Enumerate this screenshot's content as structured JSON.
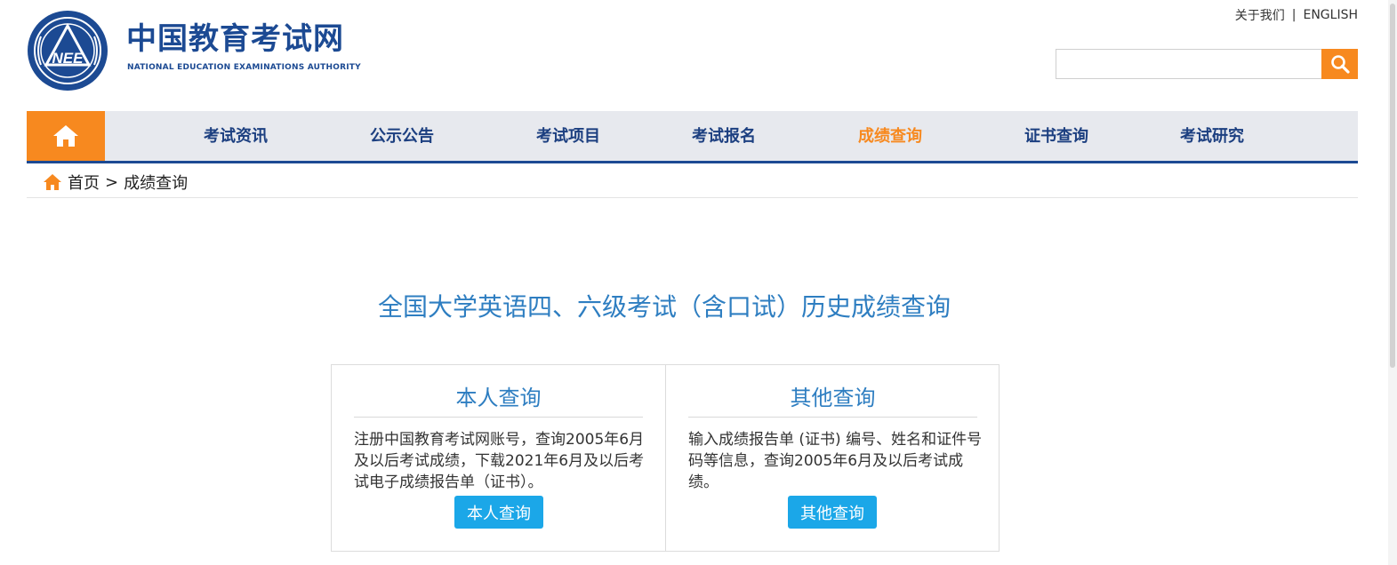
{
  "header": {
    "logo_text": "NEE",
    "site_title": "中国教育考试网",
    "site_subtitle": "NATIONAL EDUCATION EXAMINATIONS AUTHORITY",
    "links": {
      "about": "关于我们",
      "separator": "|",
      "english": "ENGLISH"
    },
    "search": {
      "value": "",
      "placeholder": ""
    }
  },
  "nav": {
    "items": [
      {
        "label": "考试资讯"
      },
      {
        "label": "公示公告"
      },
      {
        "label": "考试项目"
      },
      {
        "label": "考试报名"
      },
      {
        "label": "成绩查询",
        "active": true
      },
      {
        "label": "证书查询"
      },
      {
        "label": "考试研究"
      }
    ]
  },
  "breadcrumb": {
    "home": "首页",
    "separator": ">",
    "current": "成绩查询"
  },
  "main": {
    "title": "全国大学英语四、六级考试（含口试）历史成绩查询",
    "cards": [
      {
        "title": "本人查询",
        "description": "注册中国教育考试网账号，查询2005年6月及以后考试成绩，下载2021年6月及以后考试电子成绩报告单（证书）。",
        "button": "本人查询"
      },
      {
        "title": "其他查询",
        "description": "输入成绩报告单 (证书) 编号、姓名和证件号码等信息，查询2005年6月及以后考试成绩。",
        "button": "其他查询"
      }
    ]
  },
  "colors": {
    "brand_blue": "#1c4a93",
    "accent_orange": "#f7891f",
    "title_blue": "#2e7ec1",
    "button_blue": "#1ba7e8",
    "nav_bg": "#e7e9ee"
  },
  "icons": [
    "nee-logo-icon",
    "search-icon",
    "home-icon",
    "breadcrumb-home-icon"
  ]
}
